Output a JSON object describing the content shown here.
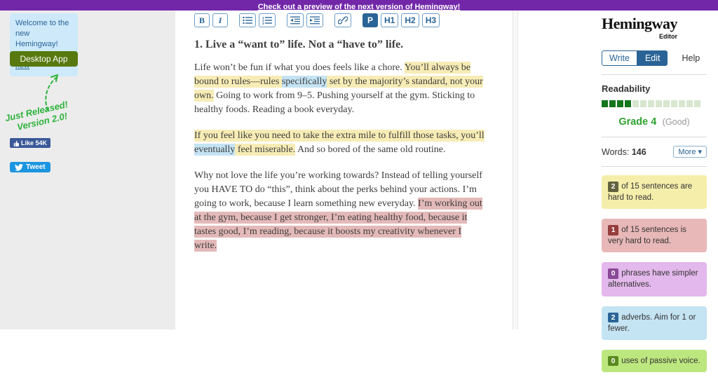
{
  "banner": {
    "text": "Check out a preview of the next version of Hemingway!"
  },
  "sidebar_left": {
    "welcome": {
      "text": "Welcome to the new Hemingway!",
      "link": "Read what's new"
    },
    "desktop_app_label": "Desktop App",
    "release_note_line1": "Just Released!",
    "release_note_line2": "Version 2.0!",
    "facebook_like_label": "Like 54K",
    "tweet_label": "Tweet"
  },
  "toolbar": {
    "bold": "B",
    "italic": "I",
    "paragraph": "P",
    "h1": "H1",
    "h2": "H2",
    "h3": "H3",
    "icon_buttons": [
      "bullet-list",
      "numbered-list",
      "outdent",
      "indent",
      "link"
    ]
  },
  "editor": {
    "heading": "1. Live a “want to” life. Not a “have to” life.",
    "paragraphs": [
      [
        {
          "t": "Life won’t be fun if what you does feels like a chore. ",
          "h": null
        },
        {
          "t": "You’ll always be bound to rules—rules ",
          "h": "yellow"
        },
        {
          "t": "specifically",
          "h": "blue"
        },
        {
          "t": " set by the majority’s standard, not your own.",
          "h": "yellow"
        },
        {
          "t": " Going to work from 9–5. Pushing yourself at the gym. Sticking to healthy foods. Reading a book everyday.",
          "h": null
        }
      ],
      [
        {
          "t": "If you feel like you need to take the extra mile to fulfill those tasks, you’ll ",
          "h": "yellow"
        },
        {
          "t": "eventually",
          "h": "blue"
        },
        {
          "t": " feel miserable.",
          "h": "yellow"
        },
        {
          "t": " And so bored of the same old routine.",
          "h": null
        }
      ],
      [
        {
          "t": "Why not love the life you’re working towards? Instead of telling yourself you HAVE TO do “this”, think about the perks behind your actions. I’m going to work, because I learn something new everyday. ",
          "h": null
        },
        {
          "t": "I’m working out at the gym, because I get stronger, I’m eating healthy food, because it tastes good, I’m reading, because it boosts my creativity whenever I write.",
          "h": "red"
        }
      ]
    ]
  },
  "sidebar_right": {
    "logo": "Hemingway",
    "logo_sub": "Editor",
    "write_label": "Write",
    "edit_label": "Edit",
    "help_label": "Help",
    "readability": {
      "title": "Readability",
      "segments_total": 13,
      "segments_filled": 4,
      "grade": "Grade 4",
      "qualifier": "(Good)"
    },
    "words_label": "Words:",
    "words_count": "146",
    "more_label": "More",
    "cards": [
      {
        "count": "2",
        "text": " of 15 sentences are hard to read.",
        "type": "yellow"
      },
      {
        "count": "1",
        "text": " of 15 sentences is very hard to read.",
        "type": "red"
      },
      {
        "count": "0",
        "text": " phrases have simpler alternatives.",
        "type": "purple"
      },
      {
        "count": "2",
        "text": " adverbs. Aim for 1 or fewer.",
        "type": "blue"
      },
      {
        "count": "0",
        "text": " uses of passive voice.",
        "type": "green"
      }
    ]
  },
  "colors": {
    "banner-bg": "#7227a9",
    "sidebar-bg": "#ececec",
    "welcome-bg": "#cde9fa",
    "link-blue": "#2a6496",
    "desktop-green": "#57790f",
    "handwritten-green": "#2db33b",
    "facebook-blue": "#3b5998",
    "tweet-blue": "#1b95e0",
    "highlight-yellow": "#f7ecb5",
    "highlight-blue": "#c4e3f3",
    "highlight-red": "#e4b9b9",
    "card-yellow": "#f5eeab",
    "card-red": "#e8b8b8",
    "card-purple": "#e3b8ec",
    "card-blue": "#c4e3f3",
    "card-green": "#bce77f",
    "badge-yellow": "#62623e",
    "badge-red": "#953c3c",
    "badge-purple": "#8a4996",
    "badge-blue": "#2a6496",
    "badge-green": "#5a8a1f",
    "grade-green": "#2da32d",
    "seg-filled": "#14751c",
    "seg-empty": "#d7e7cf"
  }
}
